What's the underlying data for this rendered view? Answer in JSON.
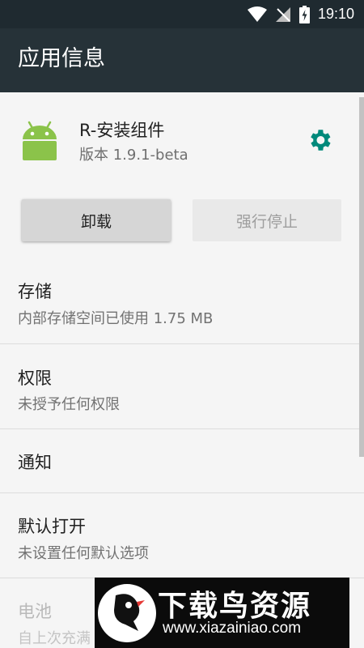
{
  "status_bar": {
    "time": "19:10"
  },
  "toolbar": {
    "title": "应用信息"
  },
  "app": {
    "name": "R-安装组件",
    "version": "版本 1.9.1-beta"
  },
  "buttons": {
    "uninstall": "卸载",
    "force_stop": "强行停止"
  },
  "sections": [
    {
      "title": "存储",
      "subtitle": "内部存储空间已使用 1.75 MB"
    },
    {
      "title": "权限",
      "subtitle": "未授予任何权限"
    },
    {
      "title": "通知",
      "subtitle": ""
    },
    {
      "title": "默认打开",
      "subtitle": "未设置任何默认选项"
    },
    {
      "title": "电池",
      "subtitle": "自上次充满"
    }
  ],
  "watermark": {
    "title": "下载鸟资源",
    "url": "www.xiazainiao.com"
  },
  "colors": {
    "toolbar": "#263238",
    "accent": "#00897b",
    "android_green": "#8bc34a"
  }
}
